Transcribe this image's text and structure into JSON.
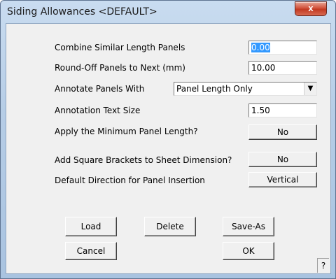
{
  "window": {
    "title": "Siding Allowances <DEFAULT>",
    "close_glyph": "x",
    "close_icon": "close-icon"
  },
  "settings": {
    "combine_label": "Combine Similar Length Panels",
    "combine_value": "0.00",
    "roundoff_label": "Round-Off Panels to Next (mm)",
    "roundoff_value": "10.00",
    "annotate_label": "Annotate Panels With",
    "annotate_value": "Panel Length Only",
    "annotate_icon": "chevron-down-icon",
    "annotate_glyph": "▼",
    "textsize_label": "Annotation Text Size",
    "textsize_value": "1.50",
    "minlength_label": "Apply the Minimum Panel Length?",
    "minlength_value": "No",
    "brackets_label": "Add Square Brackets to Sheet Dimension?",
    "brackets_value": "No",
    "direction_label": "Default Direction for Panel Insertion",
    "direction_value": "Vertical"
  },
  "buttons": {
    "load": "Load",
    "delete": "Delete",
    "save_as": "Save-As",
    "cancel": "Cancel",
    "ok": "OK",
    "help": "?"
  },
  "colors": {
    "selection": "#3399ff",
    "close_button": "#c23a22",
    "titlebar": "#b6cde6"
  }
}
